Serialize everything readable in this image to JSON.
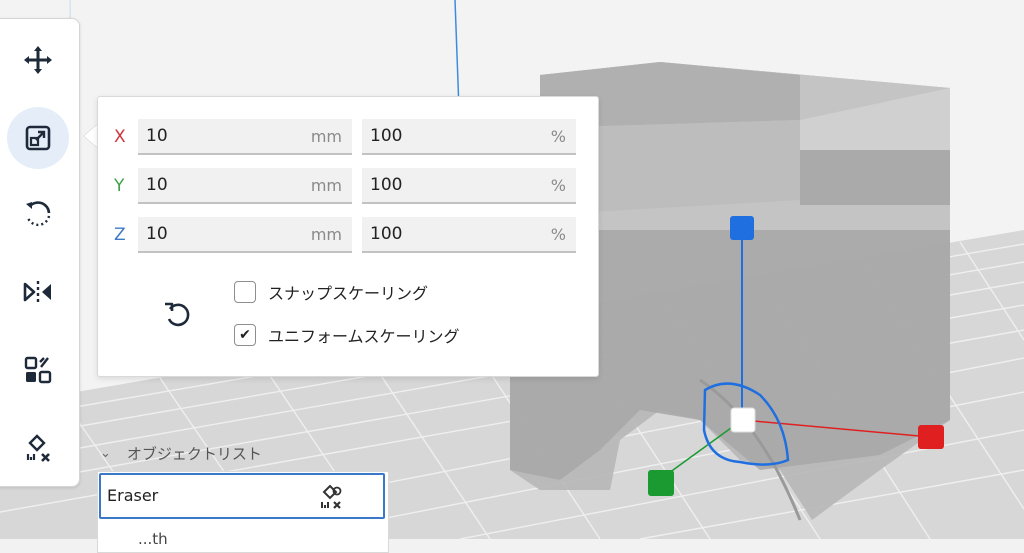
{
  "toolbar": {
    "tools": [
      {
        "name": "move-icon"
      },
      {
        "name": "scale-icon",
        "active": true
      },
      {
        "name": "rotate-icon"
      },
      {
        "name": "mirror-icon"
      },
      {
        "name": "per-model-settings-icon"
      },
      {
        "name": "support-blocker-icon"
      }
    ]
  },
  "scale_panel": {
    "rows": [
      {
        "axis": "X",
        "color": "#d0343a",
        "mm": "10",
        "mm_unit": "mm",
        "pct": "100",
        "pct_unit": "%"
      },
      {
        "axis": "Y",
        "color": "#3ea24a",
        "mm": "10",
        "mm_unit": "mm",
        "pct": "100",
        "pct_unit": "%"
      },
      {
        "axis": "Z",
        "color": "#3f78c9",
        "mm": "10",
        "mm_unit": "mm",
        "pct": "100",
        "pct_unit": "%"
      }
    ],
    "snap_scaling": {
      "label": "スナップスケーリング",
      "checked": false
    },
    "uniform_scaling": {
      "label": "ユニフォームスケーリング",
      "checked": true,
      "mark": "✔"
    }
  },
  "object_list": {
    "title": "オブジェクトリスト",
    "chevron": "⌄",
    "selected_item": "Eraser",
    "next_item": "...th"
  },
  "viewport": {
    "gizmo_colors": {
      "x": "#e02020",
      "y": "#1a9a30",
      "z": "#1f6fe0",
      "center": "#ffffff"
    }
  }
}
